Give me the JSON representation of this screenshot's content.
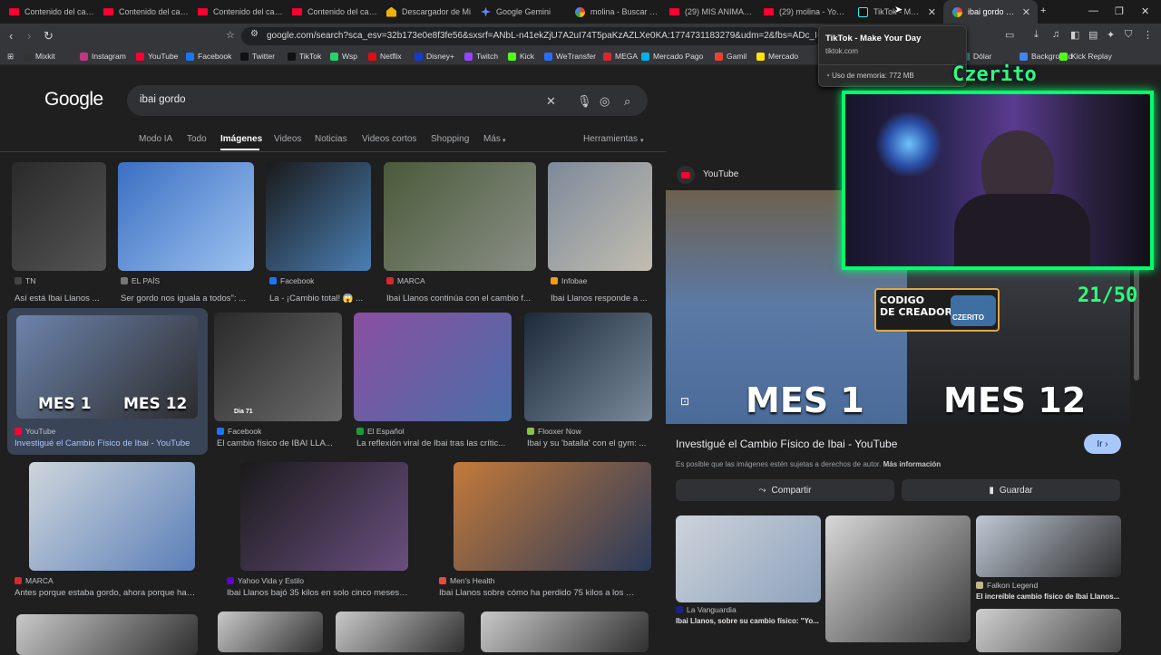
{
  "tabs": [
    {
      "label": "Contenido del canal",
      "icon": "youtube-icon"
    },
    {
      "label": "Contenido del canal",
      "icon": "youtube-icon"
    },
    {
      "label": "Contenido del canal",
      "icon": "youtube-icon"
    },
    {
      "label": "Contenido del canal",
      "icon": "youtube-icon"
    },
    {
      "label": "Descargador de Mi",
      "icon": "download-icon"
    },
    {
      "label": "Google Gemini",
      "icon": "gemini-icon"
    },
    {
      "label": "molina - Buscar con",
      "icon": "google-icon"
    },
    {
      "label": "(29) MIS ANIMALES",
      "icon": "youtube-icon"
    },
    {
      "label": "(29) molina - YouTu",
      "icon": "youtube-icon"
    },
    {
      "label": "TikTok - Make",
      "icon": "tiktok-icon"
    },
    {
      "label": "ibai gordo - Bu",
      "icon": "google-icon"
    }
  ],
  "address": {
    "url": "google.com/search?sca_esv=32b173e0e8f3fe56&sxsrf=ANbL-n41ekZjU7A2uI74T5paKzAZLXe0KA:1774731183279&udm=2&fbs=ADc_I-bpk8W4E-c"
  },
  "bookmarks": [
    "Mixkit",
    "Instagram",
    "YouTube",
    "Facebook",
    "Twitter",
    "TikTok",
    "Wsp",
    "Netflix",
    "Disney+",
    "Twitch",
    "Kick",
    "WeTransfer",
    "MEGA",
    "Mercado Pago",
    "Gamil",
    "Mercado",
    "Dólar",
    "Background",
    "Kick Replay"
  ],
  "tooltip": {
    "title": "TikTok - Make Your Day",
    "domain": "tiktok.com",
    "memory": "Uso de memoria: 772 MB"
  },
  "google": {
    "logo": "Google",
    "query": "ibai gordo"
  },
  "filters": [
    "Modo IA",
    "Todo",
    "Imágenes",
    "Videos",
    "Noticias",
    "Videos cortos",
    "Shopping",
    "Más",
    "Herramientas"
  ],
  "results": [
    {
      "source": "TN",
      "caption": "Así está Ibai Llanos ..."
    },
    {
      "source": "EL PAÍS",
      "caption": "Ser gordo nos iguala a todos\": ..."
    },
    {
      "source": "Facebook",
      "caption": "La - ¡Cambio total! 😱 ..."
    },
    {
      "source": "MARCA",
      "caption": "Ibai Llanos continúa con el cambio f..."
    },
    {
      "source": "Infobae",
      "caption": "Ibai Llanos responde a ..."
    },
    {
      "source": "YouTube",
      "caption": "Investigué el Cambio Físico de Ibai - YouTube",
      "overlay_left": "MES 1",
      "overlay_right": "MES 12"
    },
    {
      "source": "Facebook",
      "caption": "El cambio físico de IBAI LLA...",
      "tag": "Dia 71"
    },
    {
      "source": "El Español",
      "caption": "La reflexión viral de Ibai tras las crític..."
    },
    {
      "source": "Flooxer Now",
      "caption": "Ibai y su 'batalla' con el gym: ..."
    },
    {
      "source": "MARCA",
      "caption": "Antes porque estaba gordo, ahora porque ha ad..."
    },
    {
      "source": "Yahoo Vida y Estilo",
      "caption": "Ibai Llanos bajó 35 kilos en solo cinco meses y ..."
    },
    {
      "source": "Men's Health",
      "caption": "Ibai Llanos sobre cómo ha perdido 75 kilos a los 30 ..."
    }
  ],
  "panel": {
    "source": "YouTube",
    "title": "Investigué el Cambio Físico de Ibai - YouTube",
    "overlay_left": "MES 1",
    "overlay_right": "MES 12",
    "copyright": "Es posible que las imágenes estén sujetas a derechos de autor.",
    "more_info": "Más información",
    "share": "Compartir",
    "save": "Guardar",
    "go": "Ir",
    "related": [
      {
        "source": "La Vanguardia",
        "caption": "Ibai Llanos, sobre su cambio físico: \"Yo..."
      },
      {
        "source": "Falkon Legend",
        "caption": "El increíble cambio físico de Ibai Llanos..."
      }
    ]
  },
  "overlay": {
    "name": "Czerito",
    "counter": "21/50",
    "creator_line1": "CODIGO",
    "creator_line2": "DE CREADOR",
    "creator_tag": "CZERITO"
  },
  "colors": {
    "accent": "#a8c7fa",
    "stream_green": "#00ff6a",
    "youtube": "#ff0033"
  }
}
